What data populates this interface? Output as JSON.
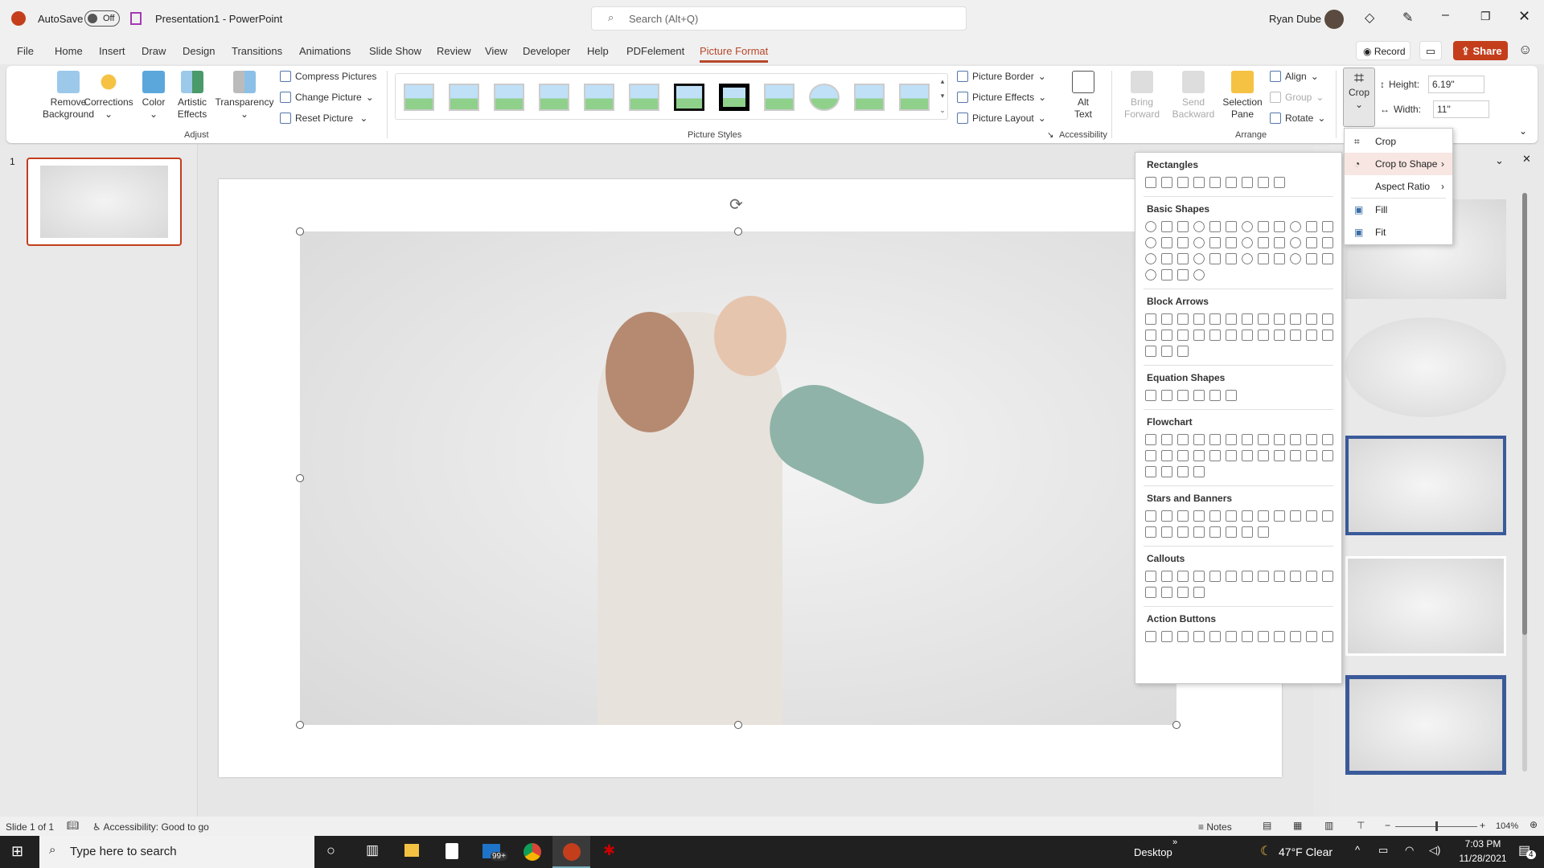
{
  "titlebar": {
    "autosave_label": "AutoSave",
    "autosave_state": "Off",
    "doc_title": "Presentation1 - PowerPoint",
    "search_placeholder": "Search (Alt+Q)",
    "user": "Ryan Dube"
  },
  "menu": {
    "tabs": [
      "File",
      "Home",
      "Insert",
      "Draw",
      "Design",
      "Transitions",
      "Animations",
      "Slide Show",
      "Review",
      "View",
      "Developer",
      "Help",
      "PDFelement",
      "Picture Format"
    ],
    "active": "Picture Format",
    "record": "Record",
    "share": "Share"
  },
  "ribbon": {
    "adjust": {
      "remove_bg": "Remove Background",
      "corrections": "Corrections",
      "color": "Color",
      "artistic": "Artistic Effects",
      "transparency": "Transparency",
      "compress": "Compress Pictures",
      "change": "Change Picture",
      "reset": "Reset Picture",
      "group": "Adjust"
    },
    "styles": {
      "group": "Picture Styles",
      "border": "Picture Border",
      "effects": "Picture Effects",
      "layout": "Picture Layout"
    },
    "accessibility": {
      "alt_text": "Alt Text",
      "group": "Accessibility"
    },
    "arrange": {
      "bring": "Bring Forward",
      "send": "Send Backward",
      "selection": "Selection Pane",
      "align": "Align",
      "group_btn": "Group",
      "rotate": "Rotate",
      "group": "Arrange"
    },
    "size": {
      "crop": "Crop",
      "height_label": "Height:",
      "height_value": "6.19\"",
      "width_label": "Width:",
      "width_value": "11\""
    }
  },
  "thumbs": {
    "slide_number": "1"
  },
  "crop_menu": {
    "items": [
      "Crop",
      "Crop to Shape",
      "Aspect Ratio",
      "Fill",
      "Fit"
    ],
    "highlighted": "Crop to Shape"
  },
  "gallery": {
    "sections": [
      "Rectangles",
      "Basic Shapes",
      "Block Arrows",
      "Equation Shapes",
      "Flowchart",
      "Stars and Banners",
      "Callouts",
      "Action Buttons"
    ]
  },
  "status": {
    "slide": "Slide 1 of 1",
    "accessibility": "Accessibility: Good to go",
    "notes": "Notes",
    "zoom": "104%"
  },
  "taskbar": {
    "search_placeholder": "Type here to search",
    "mail_badge": "99+",
    "desktop": "Desktop",
    "weather": "47°F  Clear",
    "time": "7:03 PM",
    "date": "11/28/2021",
    "notifications": "4"
  },
  "colors": {
    "accent": "#b7472a",
    "share": "#c43e1c"
  }
}
